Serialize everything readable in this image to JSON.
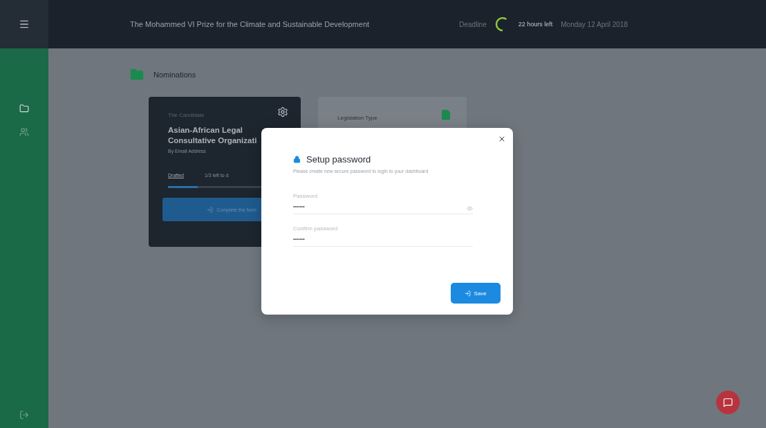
{
  "topbar": {
    "title": "The Mohammed VI Prize for the Climate and Sustainable Development",
    "deadline_label": "Deadline",
    "countdown": "22 hours left",
    "date": "Monday 12 April 2018"
  },
  "sidebar": {
    "items": [
      {
        "kind": "folder",
        "selected": true
      },
      {
        "kind": "people",
        "selected": false
      }
    ]
  },
  "page": {
    "title": "Nominations"
  },
  "cards": [
    {
      "kind": "nomination",
      "caption": "The Candidate",
      "title": "Asian-African Legal Consultative Organizati",
      "subtitle": "By Email Address",
      "tabs": [
        {
          "label": "Drafted",
          "selected": true
        },
        {
          "label": "1/3 left to d",
          "selected": false
        }
      ],
      "level": 0.25,
      "button": "Complete the form"
    },
    {
      "kind": "document",
      "title": "Legislation Type"
    }
  ],
  "dialog": {
    "title": "Setup password",
    "description": "Please create new secure password to login to your dashboard",
    "fields": [
      {
        "label": "Password",
        "value": "••••••",
        "reveal": true
      },
      {
        "label": "Confirm password",
        "value": "••••••",
        "reveal": false
      }
    ],
    "button": "Save"
  }
}
